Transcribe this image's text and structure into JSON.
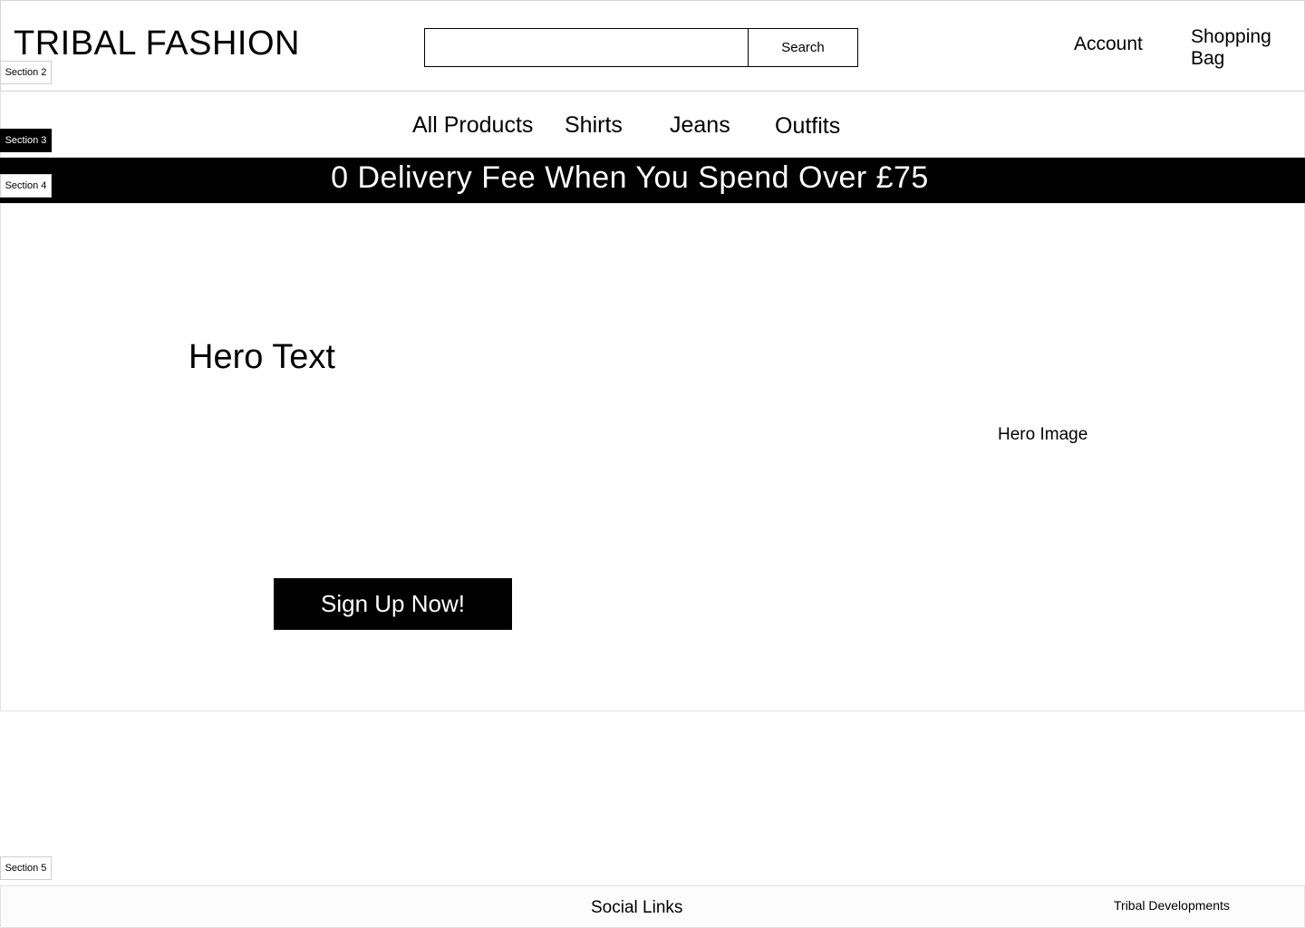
{
  "header": {
    "brand": "TRIBAL FASHION",
    "search_placeholder": "",
    "search_value": "",
    "search_label": "Search",
    "account_label": "Account",
    "bag_label": "Shopping Bag"
  },
  "nav": {
    "items": [
      "All Products",
      "Shirts",
      "Jeans",
      "Outfits"
    ]
  },
  "promo": {
    "text": "0 Delivery Fee When You Spend Over £75"
  },
  "hero": {
    "text": "Hero Text",
    "image_label": "Hero Image",
    "cta_label": "Sign Up Now!"
  },
  "footer": {
    "social_label": "Social Links",
    "credit": "Tribal Developments"
  },
  "section_tags": [
    "Section 2",
    "Section 3",
    "Section 4",
    "Section 5"
  ],
  "colors": {
    "primary": "#000000",
    "background": "#ffffff",
    "border": "#e3e3e3"
  }
}
